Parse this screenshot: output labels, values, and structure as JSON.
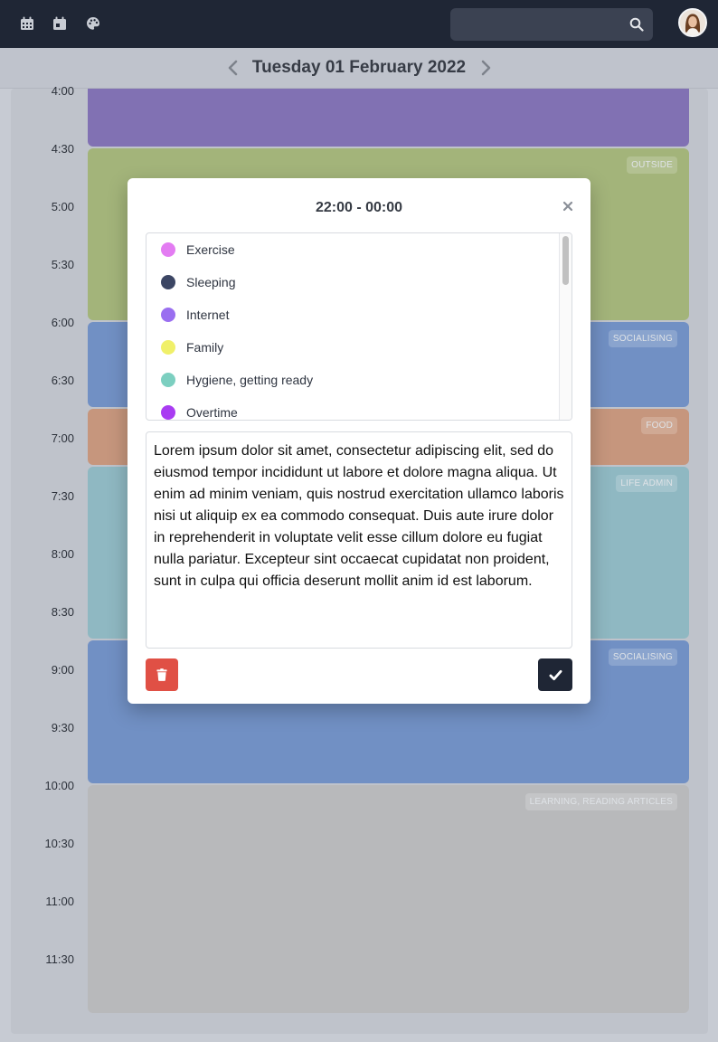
{
  "nav": {
    "icons": [
      "calendar-month-icon",
      "calendar-day-icon",
      "palette-icon",
      "search-icon",
      "avatar"
    ],
    "search": {
      "value": "",
      "placeholder": ""
    }
  },
  "date_header": {
    "title": "Tuesday 01 February 2022",
    "prev_icon": "chevron-left-icon",
    "next_icon": "chevron-right-icon"
  },
  "timeline": {
    "times": [
      "4:00",
      "4:30",
      "5:00",
      "5:30",
      "6:00",
      "6:30",
      "7:00",
      "7:30",
      "8:00",
      "8:30",
      "9:00",
      "9:30",
      "10:00",
      "10:30",
      "11:00",
      "11:30"
    ],
    "events": [
      {
        "label": "",
        "color": "#8171b3",
        "start": "3:30",
        "end": "4:30"
      },
      {
        "label": "OUTSIDE",
        "color": "#a3b47a",
        "start": "4:30",
        "end": "6:00"
      },
      {
        "label": "SOCIALISING",
        "color": "#7190c4",
        "start": "6:00",
        "end": "6:45"
      },
      {
        "label": "FOOD",
        "color": "#c6967d",
        "start": "6:45",
        "end": "7:15"
      },
      {
        "label": "LIFE ADMIN",
        "color": "#8fb8c2",
        "start": "7:15",
        "end": "8:45"
      },
      {
        "label": "SOCIALISING",
        "color": "#7190c4",
        "start": "8:45",
        "end": "10:00"
      },
      {
        "label": "LEARNING, READING ARTICLES",
        "color": "#b8b9bb",
        "start": "10:00",
        "end": "12:00"
      }
    ]
  },
  "modal": {
    "title": "22:00 - 00:00",
    "close_icon": "close-icon",
    "categories": [
      {
        "label": "Exercise",
        "color": "#e37cf2"
      },
      {
        "label": "Sleeping",
        "color": "#3c4664"
      },
      {
        "label": "Internet",
        "color": "#9a6ff0"
      },
      {
        "label": "Family",
        "color": "#f0f06a"
      },
      {
        "label": "Hygiene, getting ready",
        "color": "#7ccfc0"
      },
      {
        "label": "Overtime",
        "color": "#a93cf2"
      }
    ],
    "notes": "Lorem ipsum dolor sit amet, consectetur adipiscing elit, sed do eiusmod tempor incididunt ut labore et dolore magna aliqua. Ut enim ad minim veniam, quis nostrud exercitation ullamco laboris nisi ut aliquip ex ea commodo consequat. Duis aute irure dolor in reprehenderit in voluptate velit esse cillum dolore eu fugiat nulla pariatur. Excepteur sint occaecat cupidatat non proident, sunt in culpa qui officia deserunt mollit anim id est laborum.",
    "delete_icon": "trash-icon",
    "confirm_icon": "check-icon",
    "colors": {
      "delete": "#e05045",
      "confirm": "#1f2635"
    }
  }
}
